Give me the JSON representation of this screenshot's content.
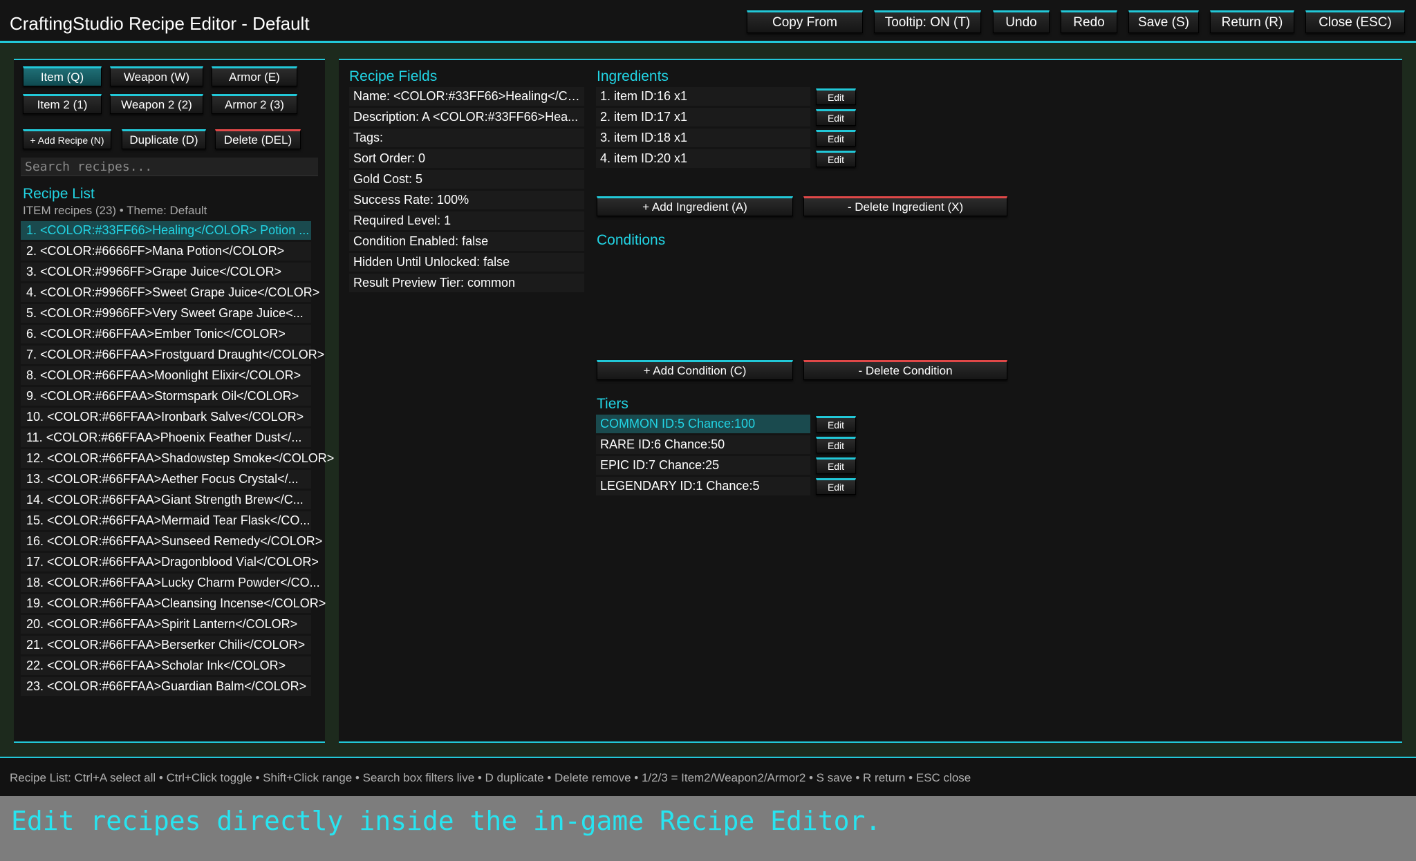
{
  "window": {
    "title": "CraftingStudio Recipe Editor - Default"
  },
  "toolbar": {
    "copy_from": "Copy From",
    "tooltip": "Tooltip: ON (T)",
    "undo": "Undo",
    "redo": "Redo",
    "save": "Save (S)",
    "return": "Return (R)",
    "close": "Close (ESC)"
  },
  "categories": {
    "item": "Item (Q)",
    "weapon": "Weapon (W)",
    "armor": "Armor (E)",
    "item2": "Item 2 (1)",
    "weapon2": "Weapon 2 (2)",
    "armor2": "Armor 2 (3)"
  },
  "actions": {
    "add_recipe": "+ Add Recipe (N)",
    "duplicate": "Duplicate (D)",
    "delete": "Delete (DEL)"
  },
  "search": {
    "placeholder": "Search recipes..."
  },
  "recipe_list": {
    "title": "Recipe List",
    "subtitle": "ITEM recipes (23) • Theme: Default",
    "items": [
      "1. <COLOR:#33FF66>Healing</COLOR> Potion ...",
      "2. <COLOR:#6666FF>Mana Potion</COLOR>",
      "3. <COLOR:#9966FF>Grape Juice</COLOR>",
      "4. <COLOR:#9966FF>Sweet Grape Juice</COLOR>",
      "5. <COLOR:#9966FF>Very Sweet Grape Juice<...",
      "6. <COLOR:#66FFAA>Ember Tonic</COLOR>",
      "7. <COLOR:#66FFAA>Frostguard Draught</COLOR>",
      "8. <COLOR:#66FFAA>Moonlight Elixir</COLOR>",
      "9. <COLOR:#66FFAA>Stormspark Oil</COLOR>",
      "10. <COLOR:#66FFAA>Ironbark Salve</COLOR>",
      "11. <COLOR:#66FFAA>Phoenix Feather Dust</...",
      "12. <COLOR:#66FFAA>Shadowstep Smoke</COLOR>",
      "13. <COLOR:#66FFAA>Aether Focus Crystal</...",
      "14. <COLOR:#66FFAA>Giant Strength Brew</C...",
      "15. <COLOR:#66FFAA>Mermaid Tear Flask</CO...",
      "16. <COLOR:#66FFAA>Sunseed Remedy</COLOR>",
      "17. <COLOR:#66FFAA>Dragonblood Vial</COLOR>",
      "18. <COLOR:#66FFAA>Lucky Charm Powder</CO...",
      "19. <COLOR:#66FFAA>Cleansing Incense</COLOR>",
      "20. <COLOR:#66FFAA>Spirit Lantern</COLOR>",
      "21. <COLOR:#66FFAA>Berserker Chili</COLOR>",
      "22. <COLOR:#66FFAA>Scholar Ink</COLOR>",
      "23. <COLOR:#66FFAA>Guardian Balm</COLOR>"
    ]
  },
  "recipe_fields": {
    "title": "Recipe Fields",
    "items": [
      "Name: <COLOR:#33FF66>Healing</COL...",
      "Description: A <COLOR:#33FF66>Hea...",
      "Tags:",
      "Sort Order: 0",
      "Gold Cost: 5",
      "Success Rate: 100%",
      "Required Level: 1",
      "Condition Enabled: false",
      "Hidden Until Unlocked: false",
      "Result Preview Tier: common"
    ]
  },
  "ingredients": {
    "title": "Ingredients",
    "items": [
      "1. item ID:16 x1",
      "2. item ID:17 x1",
      "3. item ID:18 x1",
      "4. item ID:20 x1"
    ],
    "add_label": "+ Add Ingredient (A)",
    "delete_label": "- Delete Ingredient (X)"
  },
  "conditions": {
    "title": "Conditions",
    "add_label": "+ Add Condition (C)",
    "delete_label": "- Delete Condition"
  },
  "tiers": {
    "title": "Tiers",
    "items": [
      "COMMON ID:5 Chance:100",
      "RARE ID:6 Chance:50",
      "EPIC ID:7 Chance:25",
      "LEGENDARY ID:1 Chance:5"
    ]
  },
  "edit_label": "Edit",
  "footer": {
    "hint": "Recipe List: Ctrl+A select all • Ctrl+Click toggle • Shift+Click range • Search box filters live • D duplicate • Delete remove • 1/2/3 = Item2/Weapon2/Armor2 • S save • R return • ESC close"
  },
  "caption": "Edit recipes directly inside the in-game Recipe Editor.",
  "colors": {
    "accent": "#22c8d8",
    "danger": "#e04848",
    "selection": "#1a4a4e"
  }
}
